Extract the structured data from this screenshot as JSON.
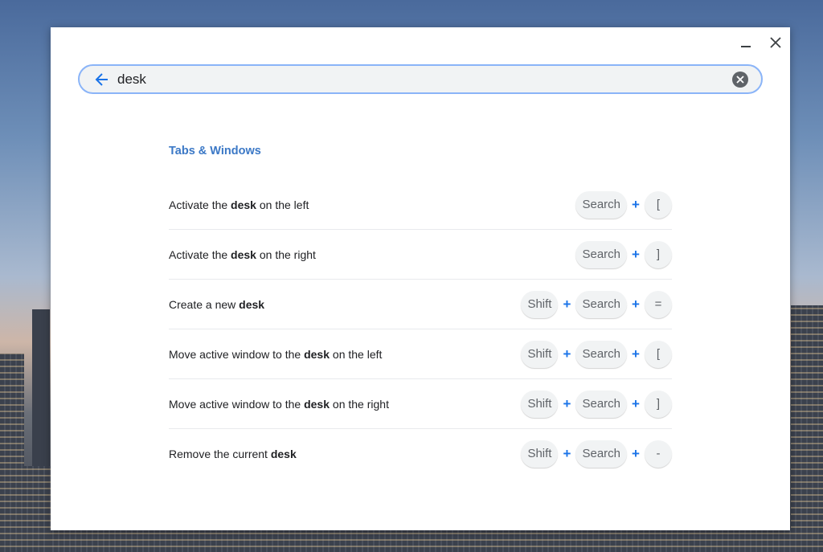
{
  "window": {
    "minimize_icon": "minimize-icon",
    "close_icon": "close-icon"
  },
  "search": {
    "value": "desk",
    "back_icon": "arrow-left-icon",
    "clear_icon": "clear-icon"
  },
  "section": {
    "title": "Tabs & Windows"
  },
  "shortcuts": [
    {
      "pre": "Activate the ",
      "bold": "desk",
      "post": " on the left",
      "keys": [
        "Search",
        "["
      ]
    },
    {
      "pre": "Activate the ",
      "bold": "desk",
      "post": " on the right",
      "keys": [
        "Search",
        "]"
      ]
    },
    {
      "pre": "Create a new ",
      "bold": "desk",
      "post": "",
      "keys": [
        "Shift",
        "Search",
        "="
      ]
    },
    {
      "pre": "Move active window to the ",
      "bold": "desk",
      "post": " on the left",
      "keys": [
        "Shift",
        "Search",
        "["
      ]
    },
    {
      "pre": "Move active window to the ",
      "bold": "desk",
      "post": " on the right",
      "keys": [
        "Shift",
        "Search",
        "]"
      ]
    },
    {
      "pre": "Remove the current ",
      "bold": "desk",
      "post": "",
      "keys": [
        "Shift",
        "Search",
        "-"
      ]
    }
  ],
  "plus_sign": "+",
  "colors": {
    "accent": "#1a73e8",
    "section_title": "#3b78c6",
    "focus_ring": "#8ab4f8"
  }
}
